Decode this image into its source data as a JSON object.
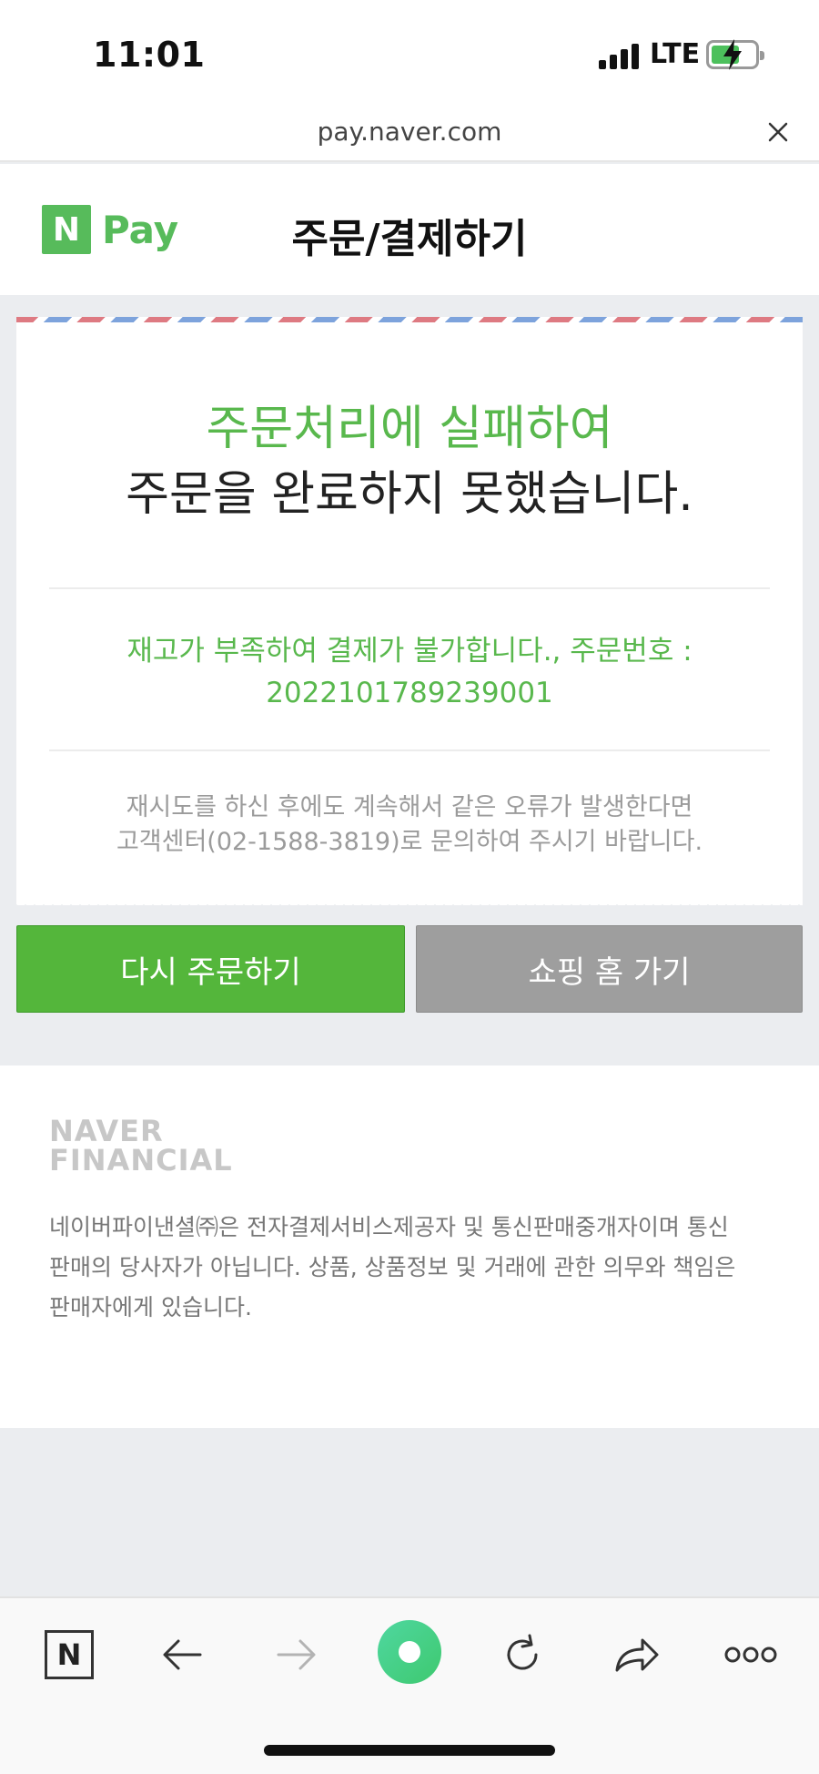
{
  "status_bar": {
    "time": "11:01",
    "network": "LTE"
  },
  "browser": {
    "url": "pay.naver.com"
  },
  "header": {
    "logo_n": "N",
    "logo_pay": "Pay",
    "title": "주문/결제하기"
  },
  "result": {
    "headline_green": "주문처리에 실패하여",
    "headline_dark": "주문을 완료하지 못했습니다.",
    "reason_line1": "재고가 부족하여 결제가 불가합니다., 주문번호 :",
    "reason_line2": "2022101789239001",
    "help_line1": "재시도를 하신 후에도 계속해서 같은 오류가 발생한다면",
    "help_line2": "고객센터(02-1588-3819)로 문의하여 주시기 바랍니다."
  },
  "buttons": {
    "retry": "다시 주문하기",
    "shopping_home": "쇼핑 홈 가기"
  },
  "footer": {
    "logo_line1": "NAVER",
    "logo_line2": "FINANCIAL",
    "disclaimer_line1": "네이버파이낸셜㈜은 전자결제서비스제공자 및 통신판매중개자이며 통신",
    "disclaimer_line2": "판매의 당사자가 아닙니다. 상품, 상품정보 및 거래에 관한 의무와 책임은",
    "disclaimer_line3": "판매자에게 있습니다."
  },
  "toolbar": {
    "naver_n": "N"
  },
  "colors": {
    "green": "#59b84d",
    "button_green": "#54b63b",
    "button_gray": "#9e9e9e"
  },
  "icons": [
    "signal-icon",
    "battery-icon",
    "close-icon",
    "back-arrow-icon",
    "forward-arrow-icon",
    "green-dot-icon",
    "refresh-icon",
    "share-icon",
    "more-icon"
  ]
}
